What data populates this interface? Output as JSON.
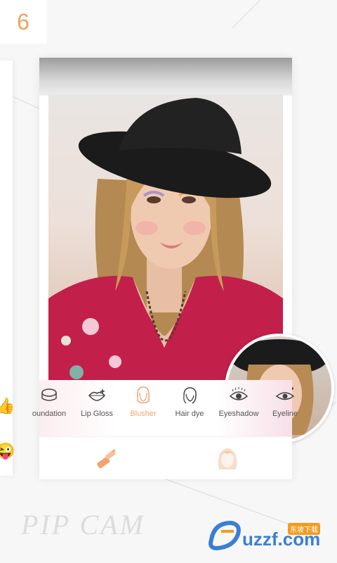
{
  "step": {
    "number": "6"
  },
  "tools": [
    {
      "label": "oundation",
      "icon": "foundation-icon"
    },
    {
      "label": "Lip Gloss",
      "icon": "lips-icon"
    },
    {
      "label": "Blusher",
      "icon": "face-icon"
    },
    {
      "label": "Hair dye",
      "icon": "hair-icon"
    },
    {
      "label": "Eyeshadow",
      "icon": "eye-icon"
    },
    {
      "label": "Eyeline",
      "icon": "eyeline-icon"
    }
  ],
  "active_tool": "Blusher",
  "tabs": [
    {
      "name": "makeup",
      "icon": "lipstick-brush-icon"
    },
    {
      "name": "portrait",
      "icon": "girl-face-icon"
    }
  ],
  "watermark": {
    "text": "PIP CAM"
  },
  "logo": {
    "text": "uzzf.com",
    "cn": "东坡下载"
  },
  "colors": {
    "accent": "#f2a470",
    "badge": "#f0a35c",
    "logo_blue": "#3a7fd6"
  }
}
